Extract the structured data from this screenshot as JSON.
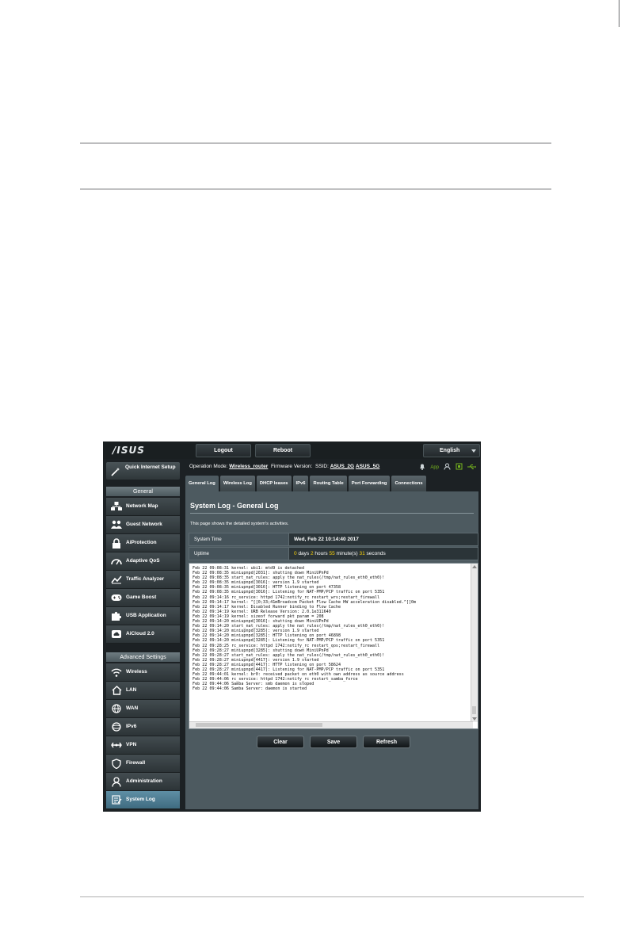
{
  "topbar": {
    "logo": "/ISUS",
    "logout": "Logout",
    "reboot": "Reboot",
    "language": "English"
  },
  "opbar": {
    "operation_mode_label": "Operation Mode:",
    "operation_mode_value": "Wireless_router",
    "firmware_label": "Firmware Version:",
    "ssid_label": "SSID:",
    "ssid_1": "ASUS_2G",
    "ssid_2": "ASUS_5G",
    "app_label": "App"
  },
  "sidebar": {
    "quick_setup": "Quick Internet Setup",
    "general_header": "General",
    "general_items": [
      "Network Map",
      "Guest Network",
      "AiProtection",
      "Adaptive QoS",
      "Traffic Analyzer",
      "Game Boost",
      "USB Application",
      "AiCloud 2.0"
    ],
    "advanced_header": "Advanced Settings",
    "advanced_items": [
      "Wireless",
      "LAN",
      "WAN",
      "IPv6",
      "VPN",
      "Firewall",
      "Administration",
      "System Log"
    ]
  },
  "tabs": [
    "General Log",
    "Wireless Log",
    "DHCP leases",
    "IPv6",
    "Routing Table",
    "Port Forwarding",
    "Connections"
  ],
  "panel": {
    "title": "System Log - General Log",
    "description": "This page shows the detailed system's activities.",
    "system_time_label": "System Time",
    "system_time_value": "Wed, Feb 22 10:14:40 2017",
    "uptime_label": "Uptime",
    "uptime_days": "0",
    "uptime_days_unit": "days",
    "uptime_hours": "2",
    "uptime_hours_unit": "hours",
    "uptime_minutes": "55",
    "uptime_minutes_unit": "minute(s)",
    "uptime_seconds": "31",
    "uptime_seconds_unit": "seconds",
    "log": "Feb 22 09:08:31 kernel: ubi1: mtd9 is detached\nFeb 22 09:08:35 miniupnpd[2031]: shutting down MiniUPnPd\nFeb 22 09:08:35 start_nat_rules: apply the nat_rules(/tmp/nat_rules_eth0_eth0)!\nFeb 22 09:08:35 miniupnpd[3016]: version 1.9 started\nFeb 22 09:08:35 miniupnpd[3016]: HTTP listening on port 47358\nFeb 22 09:08:35 miniupnpd[3016]: Listening for NAT-PMP/PCP traffic on port 5351\nFeb 22 09:14:16 rc_service: httpd 1742:notify_rc restart_wrs;restart_firewall\nFeb 22 09:14:17 kernel: ^[[0;33;41mBroadcom Packet Flow Cache HW acceleration disabled.^[[0m\nFeb 22 09:14:17 kernel: Disabled Runner binding to Flow Cache\nFeb 22 09:14:19 kernel: URB Release Version: 2.0.1e311640\nFeb 22 09:14:19 kernel: sizeof forward pkt param = 208\nFeb 22 09:14:20 miniupnpd[3016]: shutting down MiniUPnPd\nFeb 22 09:14:20 start_nat_rules: apply the nat_rules(/tmp/nat_rules_eth0_eth0)!\nFeb 22 09:14:20 miniupnpd[3285]: version 1.9 started\nFeb 22 09:14:20 miniupnpd[3285]: HTTP listening on port 46898\nFeb 22 09:14:20 miniupnpd[3285]: Listening for NAT-PMP/PCP traffic on port 5351\nFeb 22 09:28:25 rc_service: httpd 1742:notify_rc restart_qos;restart_firewall\nFeb 22 09:28:27 miniupnpd[3285]: shutting down MiniUPnPd\nFeb 22 09:28:27 start_nat_rules: apply the nat_rules(/tmp/nat_rules_eth0_eth0)!\nFeb 22 09:28:27 miniupnpd[4417]: version 1.9 started\nFeb 22 09:28:27 miniupnpd[4417]: HTTP listening on port 58624\nFeb 22 09:28:27 miniupnpd[4417]: Listening for NAT-PMP/PCP traffic on port 5351\nFeb 22 09:44:01 kernel: br0: received packet on eth0 with own address as source address\nFeb 22 09:44:06 rc_service: httpd 1742:notify_rc restart_samba_force\nFeb 22 09:44:06 Samba Server: smb daemon is stoped\nFeb 22 09:44:06 Samba Server: daemon is started",
    "clear": "Clear",
    "save": "Save",
    "refresh": "Refresh"
  },
  "colors": {
    "accent_yellow": "#fcd308",
    "active_item": "#5f8fa5",
    "panel": "#4d5a60",
    "status_green": "#76b51e"
  }
}
